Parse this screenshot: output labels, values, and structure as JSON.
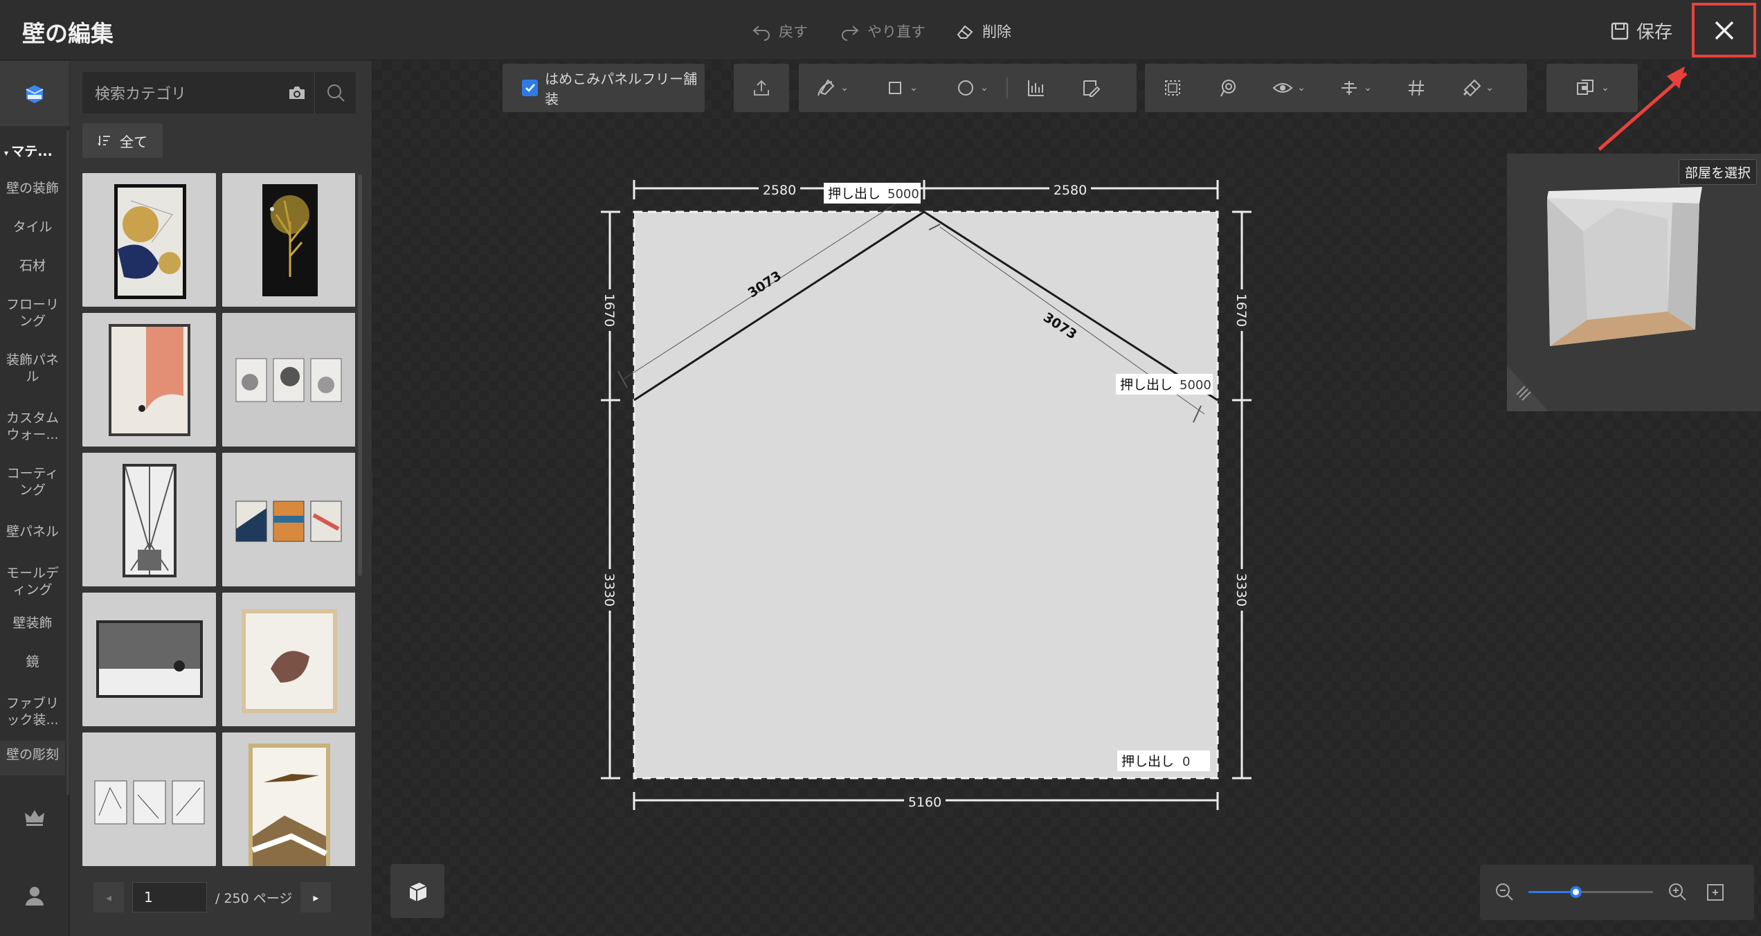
{
  "header": {
    "title": "壁の編集",
    "undo": "戻す",
    "redo": "やり直す",
    "delete": "削除",
    "save": "保存"
  },
  "rail": {
    "category_head": "マテ...",
    "items": [
      "壁の装飾",
      "タイル",
      "石材",
      "フローリ\nング",
      "装飾パネ\nル",
      "カスタム\nウォー...",
      "コーティ\nング",
      "壁パネル",
      "モールデ\nィング",
      "壁装飾",
      "鏡",
      "ファブリ\nック装...",
      "壁の彫刻"
    ]
  },
  "panel": {
    "search_placeholder": "検索カテゴリ",
    "filter_label": "全て",
    "page_value": "1",
    "page_total": "/ 250 ページ"
  },
  "toolbar": {
    "seamless_label": "はめこみパネルフリー舗装"
  },
  "drawing": {
    "extrude_label": "押し出し",
    "extrude_top": "5000",
    "extrude_right": "5000",
    "extrude_bottom": "0",
    "dim_top_left": "2580",
    "dim_top_right": "2580",
    "dim_bottom": "5160",
    "dim_left_upper": "1670",
    "dim_left_lower": "3330",
    "dim_right_upper": "1670",
    "dim_right_lower": "3330",
    "dim_slope_left": "3073",
    "dim_slope_right": "3073"
  },
  "room_preview": {
    "select_room": "部屋を選択"
  },
  "zoom": {
    "level": 0.38
  },
  "colors": {
    "accent": "#2f7be6",
    "highlight": "#e8423b"
  }
}
